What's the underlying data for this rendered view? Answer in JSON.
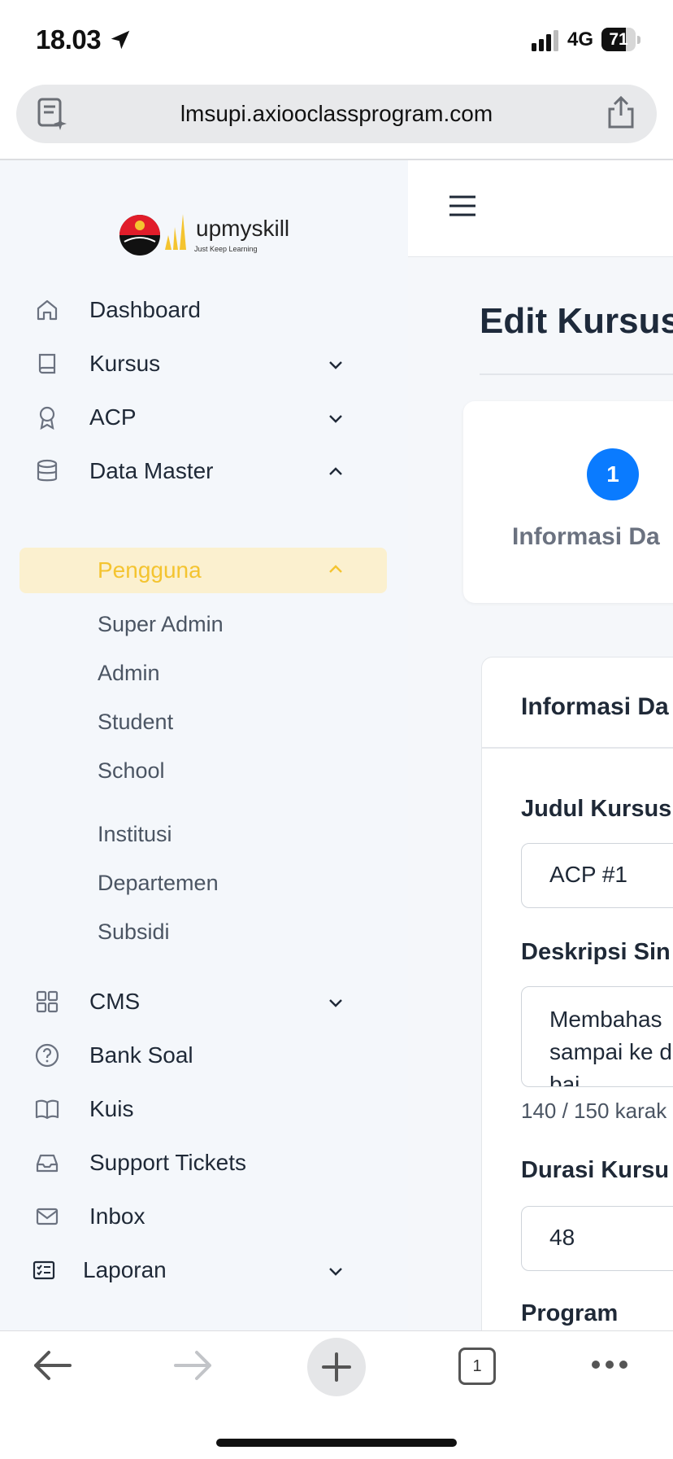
{
  "status": {
    "time": "18.03",
    "network": "4G",
    "battery": "71",
    "battery_level_percent": 71
  },
  "browser": {
    "url": "lmsupi.axiooclassprogram.com",
    "tab_count": "1"
  },
  "logo": {
    "name": "upmyskill",
    "tagline": "Just Keep Learning"
  },
  "sidebar": {
    "items": [
      {
        "label": "Dashboard",
        "icon": "home-icon"
      },
      {
        "label": "Kursus",
        "icon": "book-icon"
      },
      {
        "label": "ACP",
        "icon": "award-icon"
      },
      {
        "label": "Data Master",
        "icon": "database-icon"
      }
    ],
    "active": {
      "label": "Pengguna"
    },
    "subitems": [
      "Super Admin",
      "Admin",
      "Student",
      "School",
      "Institusi",
      "Departemen",
      "Subsidi"
    ],
    "items2": [
      {
        "label": "CMS",
        "icon": "grid-icon"
      },
      {
        "label": "Bank Soal",
        "icon": "question-circle-icon"
      },
      {
        "label": "Kuis",
        "icon": "open-book-icon"
      },
      {
        "label": "Support Tickets",
        "icon": "inbox-tray-icon"
      },
      {
        "label": "Inbox",
        "icon": "mail-icon"
      },
      {
        "label": "Laporan",
        "icon": "report-list-icon"
      }
    ]
  },
  "main": {
    "title": "Edit Kursus",
    "step": {
      "number": "1",
      "label": "Informasi Da"
    },
    "form": {
      "heading": "Informasi Da",
      "judul_label": "Judul Kursus",
      "judul_value": "ACP #1",
      "deskripsi_label": "Deskripsi Sin",
      "deskripsi_value": "Membahas\nsampai ke d\nbaj",
      "counter": "140 / 150 karak",
      "durasi_label": "Durasi Kursu",
      "durasi_value": "48",
      "program_label": "Program"
    }
  },
  "colors": {
    "accent": "#0a7bff",
    "active_bg": "#fbf0cf",
    "active_text": "#f4c430",
    "sidebar_bg": "#f4f7fb"
  }
}
